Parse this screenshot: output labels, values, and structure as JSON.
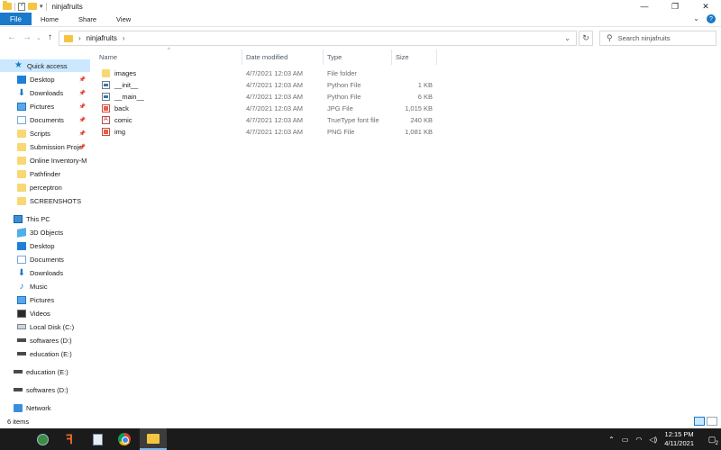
{
  "window": {
    "title": "ninjafruits"
  },
  "ribbon": {
    "tabs": [
      "File",
      "Home",
      "Share",
      "View"
    ]
  },
  "address": {
    "breadcrumb": [
      "ninjafruits"
    ],
    "search_placeholder": "Search ninjafruits"
  },
  "nav": {
    "quick_access": "Quick access",
    "quick_items": [
      {
        "label": "Desktop",
        "icon": "desktop-icon",
        "pinned": true
      },
      {
        "label": "Downloads",
        "icon": "downloads-icon",
        "pinned": true
      },
      {
        "label": "Pictures",
        "icon": "pictures-icon",
        "pinned": true
      },
      {
        "label": "Documents",
        "icon": "documents-icon",
        "pinned": true
      },
      {
        "label": "Scripts",
        "icon": "folder-icon",
        "pinned": true
      },
      {
        "label": "Submission Proje",
        "icon": "folder-icon",
        "pinned": true
      },
      {
        "label": "Online Inventory-M",
        "icon": "folder-icon",
        "pinned": false
      },
      {
        "label": "Pathfinder",
        "icon": "folder-icon",
        "pinned": false
      },
      {
        "label": "perceptron",
        "icon": "folder-icon",
        "pinned": false
      },
      {
        "label": "SCREENSHOTS",
        "icon": "folder-icon",
        "pinned": false
      }
    ],
    "this_pc": "This PC",
    "pc_items": [
      {
        "label": "3D Objects",
        "icon": "3d-objects-icon"
      },
      {
        "label": "Desktop",
        "icon": "desktop-icon"
      },
      {
        "label": "Documents",
        "icon": "documents-icon"
      },
      {
        "label": "Downloads",
        "icon": "downloads-icon"
      },
      {
        "label": "Music",
        "icon": "music-icon"
      },
      {
        "label": "Pictures",
        "icon": "pictures-icon"
      },
      {
        "label": "Videos",
        "icon": "videos-icon"
      },
      {
        "label": "Local Disk (C:)",
        "icon": "local-disk-icon"
      },
      {
        "label": "softwares (D:)",
        "icon": "drive-icon"
      },
      {
        "label": "education (E:)",
        "icon": "drive-icon"
      }
    ],
    "drives": [
      {
        "label": "education (E:)",
        "icon": "drive-icon"
      },
      {
        "label": "softwares (D:)",
        "icon": "drive-icon"
      }
    ],
    "network": "Network"
  },
  "columns": {
    "name": "Name",
    "date": "Date modified",
    "type": "Type",
    "size": "Size"
  },
  "files": [
    {
      "name": "images",
      "date": "4/7/2021 12:03 AM",
      "type": "File folder",
      "size": "",
      "icon": "folder-icon"
    },
    {
      "name": "__init__",
      "date": "4/7/2021 12:03 AM",
      "type": "Python File",
      "size": "1 KB",
      "icon": "python-file-icon"
    },
    {
      "name": "__main__",
      "date": "4/7/2021 12:03 AM",
      "type": "Python File",
      "size": "6 KB",
      "icon": "python-file-icon"
    },
    {
      "name": "back",
      "date": "4/7/2021 12:03 AM",
      "type": "JPG File",
      "size": "1,015 KB",
      "icon": "image-file-icon"
    },
    {
      "name": "comic",
      "date": "4/7/2021 12:03 AM",
      "type": "TrueType font file",
      "size": "240 KB",
      "icon": "font-file-icon"
    },
    {
      "name": "img",
      "date": "4/7/2021 12:03 AM",
      "type": "PNG File",
      "size": "1,081 KB",
      "icon": "image-file-icon"
    }
  ],
  "status": {
    "item_count": "6 items"
  },
  "taskbar": {
    "time": "12:15 PM",
    "date": "4/11/2021",
    "notifications": "2"
  }
}
